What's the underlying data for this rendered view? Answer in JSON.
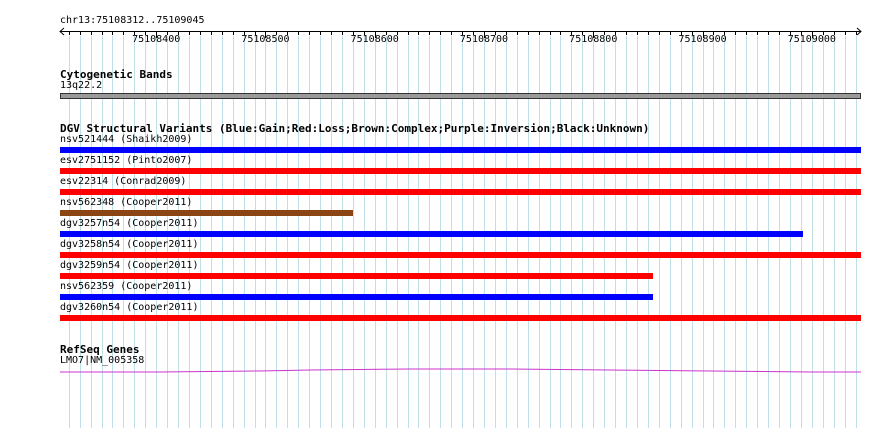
{
  "ruler": {
    "range_label": "chr13:75108312..75109045",
    "start": 75108312,
    "end": 75109045,
    "ticks": [
      "75108400",
      "75108500",
      "75108600",
      "75108700",
      "75108800",
      "75108900",
      "75109000"
    ]
  },
  "cytoband": {
    "title": "Cytogenetic Bands",
    "band": "13q22.2"
  },
  "dgv": {
    "title": "DGV Structural Variants (Blue:Gain;Red:Loss;Brown:Complex;Purple:Inversion;Black:Unknown)",
    "colors": {
      "gain": "#0000ff",
      "loss": "#ff0000",
      "complex": "#8b4513"
    },
    "variants": [
      {
        "label": "nsv521444 (Shaikh2009)",
        "type": "gain",
        "start": 75108312,
        "end": 75109045
      },
      {
        "label": "esv2751152 (Pinto2007)",
        "type": "loss",
        "start": 75108312,
        "end": 75109045
      },
      {
        "label": "esv22314 (Conrad2009)",
        "type": "loss",
        "start": 75108312,
        "end": 75109045
      },
      {
        "label": "nsv562348 (Cooper2011)",
        "type": "complex",
        "start": 75108312,
        "end": 75108580
      },
      {
        "label": "dgv3257n54 (Cooper2011)",
        "type": "gain",
        "start": 75108312,
        "end": 75108992
      },
      {
        "label": "dgv3258n54 (Cooper2011)",
        "type": "loss",
        "start": 75108312,
        "end": 75109045
      },
      {
        "label": "dgv3259n54 (Cooper2011)",
        "type": "loss",
        "start": 75108312,
        "end": 75108855
      },
      {
        "label": "nsv562359 (Cooper2011)",
        "type": "gain",
        "start": 75108312,
        "end": 75108855
      },
      {
        "label": "dgv3260n54 (Cooper2011)",
        "type": "loss",
        "start": 75108312,
        "end": 75109045
      }
    ]
  },
  "refseq": {
    "title": "RefSeq Genes",
    "gene": "LMO7|NM_005358",
    "color": "#cc33cc"
  }
}
